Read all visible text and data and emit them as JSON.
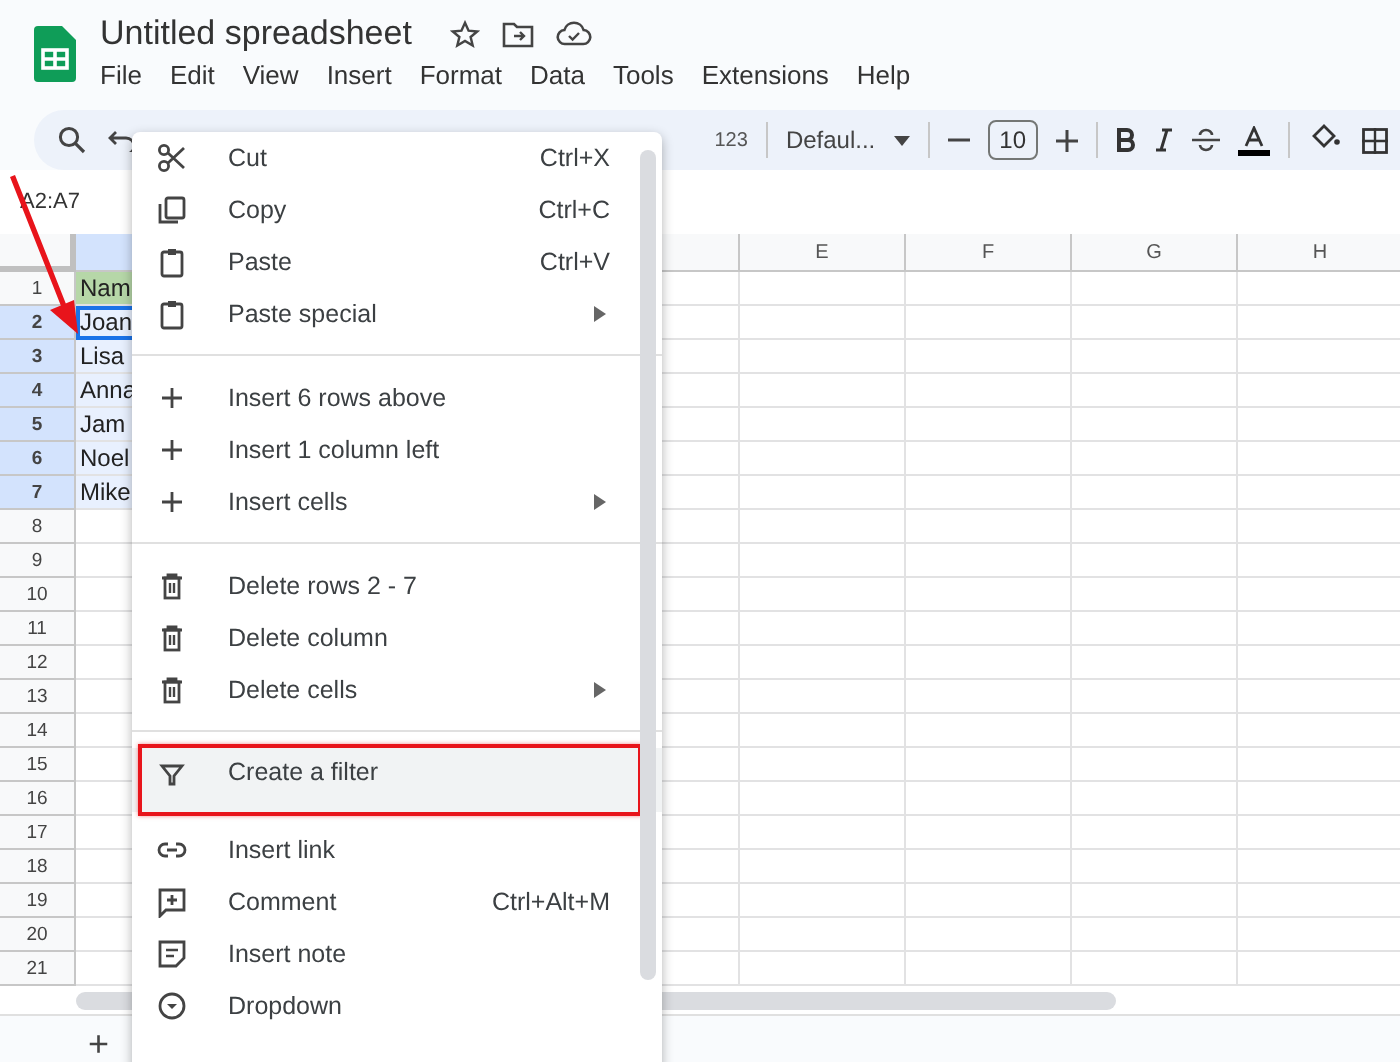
{
  "app": {
    "title": "Untitled spreadsheet",
    "menu": [
      "File",
      "Edit",
      "View",
      "Insert",
      "Format",
      "Data",
      "Tools",
      "Extensions",
      "Help"
    ]
  },
  "toolbar": {
    "number_format": "123",
    "font": "Defaul...",
    "font_size": "10"
  },
  "name_box": "A2:A7",
  "columns": [
    "E",
    "F",
    "G",
    "H"
  ],
  "rows": [
    {
      "number": "1",
      "cell": "Nam",
      "selected": false,
      "active": false,
      "highlighted": true
    },
    {
      "number": "2",
      "cell": "Joan",
      "selected": true,
      "active": true,
      "highlighted": false
    },
    {
      "number": "3",
      "cell": "Lisa",
      "selected": true,
      "active": false,
      "highlighted": false
    },
    {
      "number": "4",
      "cell": "Anna",
      "selected": true,
      "active": false,
      "highlighted": false
    },
    {
      "number": "5",
      "cell": "Jam",
      "selected": true,
      "active": false,
      "highlighted": false
    },
    {
      "number": "6",
      "cell": "Noel",
      "selected": true,
      "active": false,
      "highlighted": false
    },
    {
      "number": "7",
      "cell": "Mike",
      "selected": true,
      "active": false,
      "highlighted": false
    },
    {
      "number": "8",
      "selected": false,
      "active": false,
      "highlighted": false
    },
    {
      "number": "9",
      "selected": false,
      "active": false,
      "highlighted": false
    },
    {
      "number": "10",
      "selected": false,
      "active": false,
      "highlighted": false
    },
    {
      "number": "11",
      "selected": false,
      "active": false,
      "highlighted": false
    },
    {
      "number": "12",
      "selected": false,
      "active": false,
      "highlighted": false
    },
    {
      "number": "13",
      "selected": false,
      "active": false,
      "highlighted": false
    },
    {
      "number": "14",
      "selected": false,
      "active": false,
      "highlighted": false
    },
    {
      "number": "15",
      "selected": false,
      "active": false,
      "highlighted": false
    },
    {
      "number": "16",
      "selected": false,
      "active": false,
      "highlighted": false
    },
    {
      "number": "17",
      "selected": false,
      "active": false,
      "highlighted": false
    },
    {
      "number": "18",
      "selected": false,
      "active": false,
      "highlighted": false
    },
    {
      "number": "19",
      "selected": false,
      "active": false,
      "highlighted": false
    },
    {
      "number": "20",
      "selected": false,
      "active": false,
      "highlighted": false
    },
    {
      "number": "21",
      "selected": false,
      "active": false,
      "highlighted": false
    }
  ],
  "context_menu": {
    "items": [
      {
        "kind": "cut",
        "label": "Cut",
        "shortcut": "Ctrl+X",
        "submenu": false,
        "selected": false,
        "outlined": false
      },
      {
        "kind": "copy",
        "label": "Copy",
        "shortcut": "Ctrl+C",
        "submenu": false,
        "selected": false,
        "outlined": false
      },
      {
        "kind": "paste",
        "label": "Paste",
        "shortcut": "Ctrl+V",
        "submenu": false,
        "selected": false,
        "outlined": false
      },
      {
        "kind": "paste",
        "label": "Paste special",
        "submenu": true,
        "selected": false,
        "outlined": false
      },
      {
        "kind": "divider"
      },
      {
        "kind": "insert",
        "label": "Insert 6 rows above",
        "submenu": false,
        "selected": false,
        "outlined": false
      },
      {
        "kind": "insert",
        "label": "Insert 1 column left",
        "submenu": false,
        "selected": false,
        "outlined": false
      },
      {
        "kind": "insert",
        "label": "Insert cells",
        "submenu": true,
        "selected": false,
        "outlined": false
      },
      {
        "kind": "divider"
      },
      {
        "kind": "delete",
        "label": "Delete rows 2 - 7",
        "submenu": false,
        "selected": false,
        "outlined": false
      },
      {
        "kind": "delete",
        "label": "Delete column",
        "submenu": false,
        "selected": false,
        "outlined": false
      },
      {
        "kind": "delete",
        "label": "Delete cells",
        "submenu": true,
        "selected": false,
        "outlined": false
      },
      {
        "kind": "divider"
      },
      {
        "kind": "filter",
        "label": "Create a filter",
        "submenu": false,
        "selected": true,
        "outlined": true
      },
      {
        "kind": "link",
        "label": "Insert link",
        "submenu": false,
        "selected": false,
        "outlined": false
      },
      {
        "kind": "comment",
        "label": "Comment",
        "shortcut": "Ctrl+Alt+M",
        "submenu": false,
        "selected": false,
        "outlined": false
      },
      {
        "kind": "note",
        "label": "Insert note",
        "submenu": false,
        "selected": false,
        "outlined": false
      },
      {
        "kind": "dropdown",
        "label": "Dropdown",
        "submenu": false,
        "selected": false,
        "outlined": false
      }
    ]
  },
  "sheet_bar": {
    "add_label": "+"
  }
}
